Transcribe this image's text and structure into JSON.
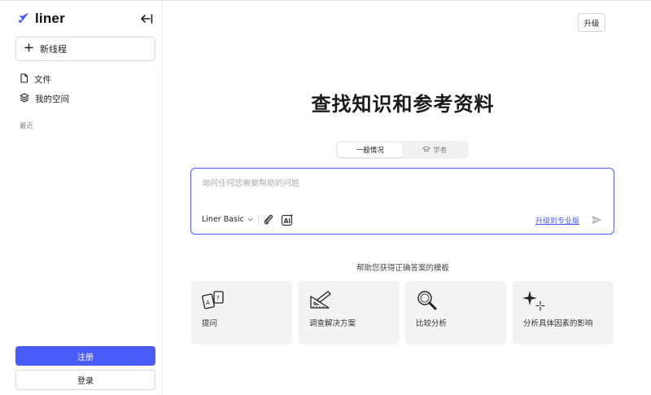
{
  "app": {
    "name": "liner"
  },
  "sidebar": {
    "new_thread_label": "新线程",
    "items": [
      {
        "label": "文件",
        "icon": "file-icon"
      },
      {
        "label": "我的空间",
        "icon": "layers-icon"
      }
    ],
    "recent_label": "最近",
    "signup_label": "注册",
    "login_label": "登录"
  },
  "header": {
    "upgrade_label": "升级"
  },
  "main": {
    "headline": "查找知识和参考资料",
    "modes": [
      {
        "label": "一般情况",
        "active": true
      },
      {
        "label": "学者",
        "active": false,
        "icon": "graduation-cap-icon"
      }
    ],
    "composer": {
      "placeholder": "询问任何您需要帮助的问题",
      "value": "",
      "model": "Liner Basic",
      "pro_link": "升级到专业版"
    },
    "templates_title": "帮助您获得正确答案的模板",
    "templates": [
      {
        "label": "提问",
        "icon": "question-cards-icon"
      },
      {
        "label": "调查解决方案",
        "icon": "ruler-pencil-icon"
      },
      {
        "label": "比较分析",
        "icon": "magnifier-icon"
      },
      {
        "label": "分析具体因素的影响",
        "icon": "sparkle-icon"
      }
    ]
  },
  "colors": {
    "accent": "#4a5cf7",
    "card_bg": "#f3f3f3",
    "border": "#d9d9d9"
  }
}
